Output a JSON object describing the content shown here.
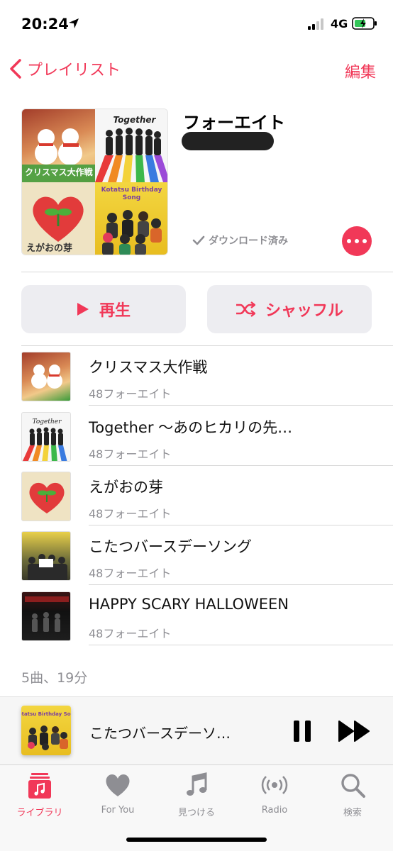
{
  "status_bar": {
    "time": "20:24",
    "network": "4G",
    "icons": [
      "location-arrow-icon",
      "signal-icon",
      "battery-charging-icon"
    ]
  },
  "nav": {
    "back_label": "プレイリスト",
    "edit_label": "編集"
  },
  "playlist": {
    "title": "フォーエイト",
    "download_status": "ダウンロード済み",
    "artwork_tiles": [
      {
        "label": "クリスマス大作戦"
      },
      {
        "label": "Together"
      },
      {
        "label": "えがおの芽"
      },
      {
        "label": "Kotatsu Birthday Song"
      }
    ]
  },
  "buttons": {
    "play_label": "再生",
    "shuffle_label": "シャッフル"
  },
  "tracks": [
    {
      "title": "クリスマス大作戦",
      "artist": "48フォーエイト",
      "art_label": "クリスマス大作戦"
    },
    {
      "title": "Together 〜あのヒカリの先…",
      "artist": "48フォーエイト",
      "art_label": "Together"
    },
    {
      "title": "えがおの芽",
      "artist": "48フォーエイト",
      "art_label": "えがおの芽"
    },
    {
      "title": "こたつバースデーソング",
      "artist": "48フォーエイト",
      "art_label": "Kotatsu Birthday Song"
    },
    {
      "title": "HAPPY SCARY HALLOWEEN",
      "artist": "48フォーエイト",
      "art_label": "HAPPY SCARY HALLOWEEN"
    }
  ],
  "summary": "5曲、19分",
  "now_playing": {
    "title": "こたつバースデーソ…",
    "art_label": "Kotatsu Birthday Song"
  },
  "tabs": [
    {
      "label": "ライブラリ",
      "icon": "library-icon",
      "active": true
    },
    {
      "label": "For You",
      "icon": "heart-icon",
      "active": false
    },
    {
      "label": "見つける",
      "icon": "music-note-icon",
      "active": false
    },
    {
      "label": "Radio",
      "icon": "radio-icon",
      "active": false
    },
    {
      "label": "検索",
      "icon": "search-icon",
      "active": false
    }
  ],
  "colors": {
    "accent": "#f13858",
    "secondary_text": "#8e8e93",
    "button_bg": "#ededf1"
  }
}
